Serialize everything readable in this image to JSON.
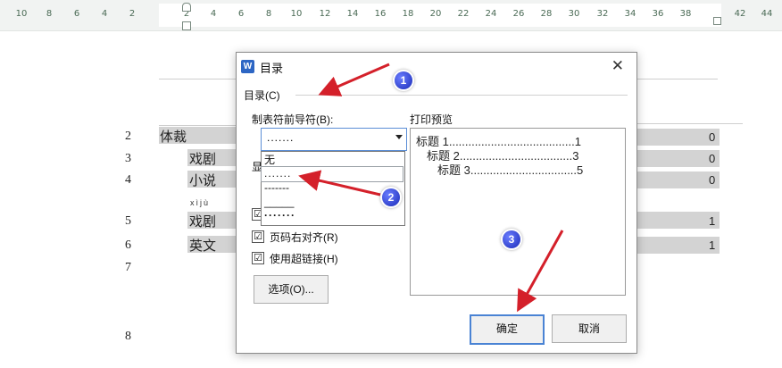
{
  "ruler": {
    "ticks": [
      "10",
      "8",
      "6",
      "4",
      "2",
      "2",
      "4",
      "6",
      "8",
      "10",
      "12",
      "14",
      "16",
      "18",
      "20",
      "22",
      "24",
      "26",
      "28",
      "30",
      "32",
      "34",
      "36",
      "38",
      "42",
      "44"
    ]
  },
  "document": {
    "line_numbers": [
      "2",
      "3",
      "4",
      "5",
      "6",
      "7",
      "8"
    ],
    "entries": [
      {
        "text": "体裁",
        "page": "0"
      },
      {
        "text": "戏剧",
        "page": "0"
      },
      {
        "text": "小说",
        "page": "0"
      },
      {
        "text": "戏剧",
        "page": "1"
      },
      {
        "text": "英文",
        "page": "1"
      }
    ],
    "pinyin": "xìjù",
    "partial_label": "显"
  },
  "dialog": {
    "logo": "W",
    "title": "目录",
    "section_label": "目录(C)",
    "leader_label": "制表符前导符(B):",
    "leader_value": ".......",
    "preview_label": "打印预览",
    "dropdown_options": [
      "无",
      ".......",
      "-------",
      "_____",
      "·······"
    ],
    "preview_lines": [
      "标题 1.......................................1",
      "标题 2...................................3",
      "标题 3.................................5"
    ],
    "checkboxes": [
      {
        "label": "页码右对齐(R)",
        "checked": "☑"
      },
      {
        "label": "使用超链接(H)",
        "checked": "☑"
      }
    ],
    "options_button": "选项(O)...",
    "ok_button": "确定",
    "cancel_button": "取消"
  },
  "annotations": {
    "badges": [
      "1",
      "2",
      "3"
    ],
    "arrow_color": "#d4202a"
  },
  "colors": {
    "ruler_bg": "#f1f3f2",
    "toc_highlight": "#d3d3d3",
    "primary_border": "#4a83d4",
    "word_logo": "#2d66c4"
  }
}
